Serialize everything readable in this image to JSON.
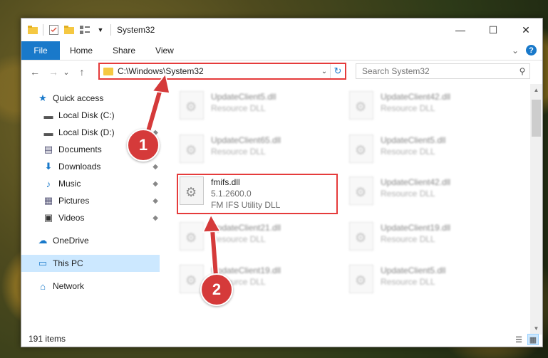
{
  "window": {
    "title": "System32",
    "controls": {
      "minimize": "—",
      "maximize": "☐",
      "close": "✕"
    }
  },
  "ribbon": {
    "file_tab": "File",
    "tabs": [
      "Home",
      "Share",
      "View"
    ],
    "expand_symbol": "⌄",
    "help_symbol": "?"
  },
  "nav_buttons": {
    "back": "←",
    "forward": "→",
    "recent": "⌄",
    "up": "↑"
  },
  "address": {
    "path": "C:\\Windows\\System32",
    "dropdown_symbol": "⌄",
    "refresh_symbol": "↻"
  },
  "search": {
    "placeholder": "Search System32",
    "icon_symbol": "⚲"
  },
  "sidebar": {
    "items": [
      {
        "label": "Quick access",
        "icon": "star-icon",
        "glyph": "★"
      },
      {
        "label": "Local Disk (C:)",
        "icon": "drive-icon",
        "glyph": "▬"
      },
      {
        "label": "Local Disk (D:)",
        "icon": "drive-icon",
        "glyph": "▬"
      },
      {
        "label": "Documents",
        "icon": "documents-icon",
        "glyph": "▤"
      },
      {
        "label": "Downloads",
        "icon": "downloads-icon",
        "glyph": "⬇"
      },
      {
        "label": "Music",
        "icon": "music-icon",
        "glyph": "♪"
      },
      {
        "label": "Pictures",
        "icon": "pictures-icon",
        "glyph": "▦"
      },
      {
        "label": "Videos",
        "icon": "videos-icon",
        "glyph": "▣"
      },
      {
        "label": "OneDrive",
        "icon": "onedrive-icon",
        "glyph": "☁"
      },
      {
        "label": "This PC",
        "icon": "computer-icon",
        "glyph": "▭"
      },
      {
        "label": "Network",
        "icon": "network-icon",
        "glyph": "⌂"
      }
    ],
    "pin_symbol": "📌"
  },
  "files": {
    "left": [
      {
        "name": "UpdateClient5.dll",
        "type": "Resource DLL"
      },
      {
        "name": "UpdateClient65.dll",
        "type": "Resource DLL"
      },
      {
        "name": "fmifs.dll",
        "version": "5.1.2600.0",
        "type": "FM IFS Utility DLL"
      },
      {
        "name": "UpdateClient21.dll",
        "type": "Resource DLL"
      },
      {
        "name": "UpdateClient19.dll",
        "type": "Resource DLL"
      }
    ],
    "right": [
      {
        "name": "UpdateClient42.dll",
        "type": "Resource DLL"
      },
      {
        "name": "UpdateClient5.dll",
        "type": "Resource DLL"
      },
      {
        "name": "UpdateClient42.dll",
        "type": "Resource DLL"
      },
      {
        "name": "UpdateClient19.dll",
        "type": "Resource DLL"
      },
      {
        "name": "UpdateClient5.dll",
        "type": "Resource DLL"
      }
    ]
  },
  "status": {
    "item_count": "191 items"
  },
  "callouts": {
    "one": "1",
    "two": "2"
  },
  "colors": {
    "accent": "#1979ca",
    "highlight": "#e53b3b",
    "selection": "#cce8ff"
  }
}
